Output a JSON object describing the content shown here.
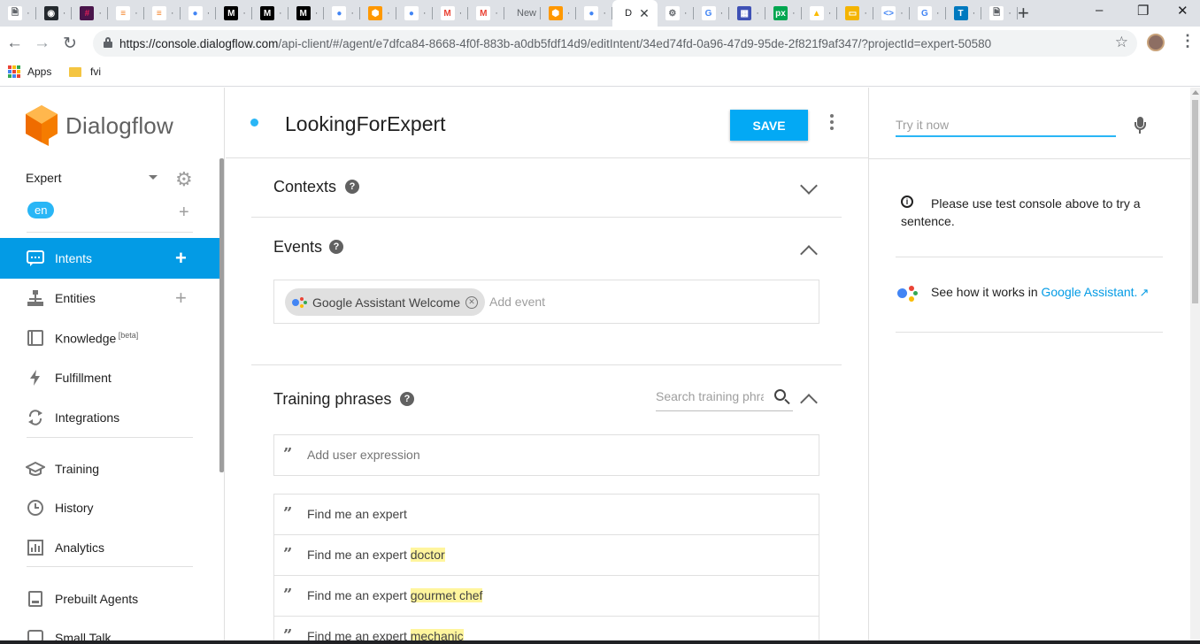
{
  "browser": {
    "tabs": [
      {
        "icon": "doc-icon",
        "title": ""
      },
      {
        "icon": "github-icon",
        "title": ""
      },
      {
        "icon": "slack-icon",
        "title": ""
      },
      {
        "icon": "stackoverflow-icon",
        "title": ""
      },
      {
        "icon": "stackoverflow-icon",
        "title": ""
      },
      {
        "icon": "google-assistant-icon",
        "title": ""
      },
      {
        "icon": "medium-icon",
        "title": ""
      },
      {
        "icon": "medium-icon",
        "title": ""
      },
      {
        "icon": "medium-icon",
        "title": ""
      },
      {
        "icon": "google-assistant-icon",
        "title": ""
      },
      {
        "icon": "dialogflow-icon",
        "title": ""
      },
      {
        "icon": "google-assistant-icon",
        "title": ""
      },
      {
        "icon": "gmail-icon",
        "title": ""
      },
      {
        "icon": "gmail-icon",
        "title": ""
      },
      {
        "icon": "",
        "title": "New"
      },
      {
        "icon": "dialogflow-icon",
        "title": ""
      },
      {
        "icon": "google-assistant-icon",
        "title": ""
      },
      {
        "icon": "",
        "title": "D",
        "active": true
      },
      {
        "icon": "chrome-icon",
        "title": ""
      },
      {
        "icon": "google-icon",
        "title": ""
      },
      {
        "icon": "grid-icon",
        "title": ""
      },
      {
        "icon": "pixlr-icon",
        "title": ""
      },
      {
        "icon": "drive-icon",
        "title": ""
      },
      {
        "icon": "slides-icon",
        "title": ""
      },
      {
        "icon": "code-icon",
        "title": ""
      },
      {
        "icon": "google-icon",
        "title": ""
      },
      {
        "icon": "trello-icon",
        "title": ""
      },
      {
        "icon": "doc-icon",
        "title": ""
      }
    ],
    "url_host": "https://console.dialogflow.com",
    "url_path": "/api-client/#/agent/e7dfca84-8668-4f0f-883b-a0db5fdf14d9/editIntent/34ed74fd-0a96-47d9-95de-2f821f9af347/?projectId=expert-50580",
    "bookmarks": {
      "apps_label": "Apps",
      "folder_label": "fvi"
    }
  },
  "sidebar": {
    "logo_text": "Dialogflow",
    "agent_name": "Expert",
    "language": "en",
    "items": [
      {
        "label": "Intents",
        "icon": "intents-icon",
        "has_add": true,
        "active": true
      },
      {
        "label": "Entities",
        "icon": "entities-icon",
        "has_add": true
      },
      {
        "label": "Knowledge",
        "sup": "[beta]",
        "icon": "knowledge-icon"
      },
      {
        "label": "Fulfillment",
        "icon": "fulfillment-icon"
      },
      {
        "label": "Integrations",
        "icon": "integrations-icon"
      },
      {
        "label": "Training",
        "icon": "training-icon"
      },
      {
        "label": "History",
        "icon": "history-icon"
      },
      {
        "label": "Analytics",
        "icon": "analytics-icon"
      },
      {
        "label": "Prebuilt Agents",
        "icon": "prebuilt-agents-icon"
      },
      {
        "label": "Small Talk",
        "icon": "small-talk-icon"
      }
    ]
  },
  "main": {
    "intent_name": "LookingForExpert",
    "save_label": "SAVE",
    "contexts": {
      "title": "Contexts"
    },
    "events": {
      "title": "Events",
      "chips": [
        "Google Assistant Welcome"
      ],
      "add_placeholder": "Add event"
    },
    "training": {
      "title": "Training phrases",
      "search_placeholder": "Search training phrases",
      "add_placeholder": "Add user expression",
      "phrases": [
        {
          "prefix": "Find me an expert",
          "entity": ""
        },
        {
          "prefix": "Find me an expert ",
          "entity": "doctor"
        },
        {
          "prefix": "Find me an expert ",
          "entity": "gourmet chef"
        },
        {
          "prefix": "Find me an expert ",
          "entity": "mechanic"
        }
      ]
    }
  },
  "console": {
    "try_placeholder": "Try it now",
    "info_text": "Please use test console above to try a sentence.",
    "see_how_prefix": "See how it works in ",
    "see_how_link": "Google Assistant."
  },
  "colors": {
    "accent": "#039be5",
    "save_button": "#03a9f4",
    "entity_highlight": "#fff59d"
  }
}
